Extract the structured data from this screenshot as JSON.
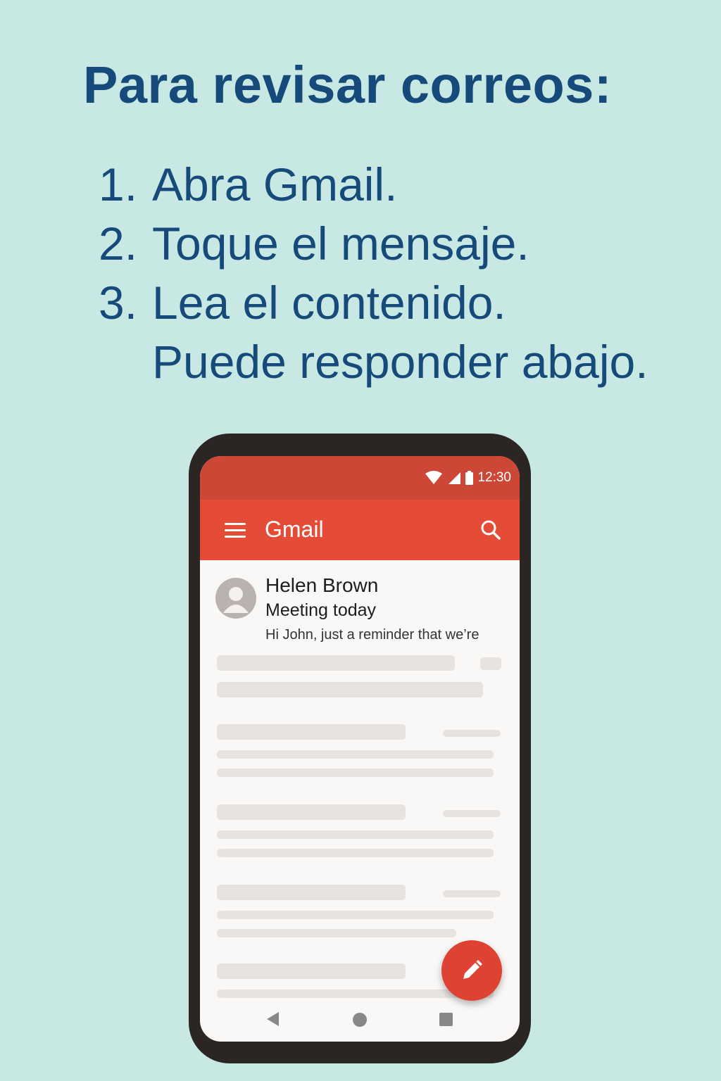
{
  "heading": "Para revisar correos:",
  "steps": [
    {
      "num": "1.",
      "text": "Abra Gmail."
    },
    {
      "num": "2.",
      "text": "Toque el mensaje."
    },
    {
      "num": "3.",
      "text": "Lea el contenido."
    }
  ],
  "step_continuation": "Puede responder abajo.",
  "phone": {
    "status_time": "12:30",
    "app_title": "Gmail",
    "email": {
      "sender": "Helen Brown",
      "subject": "Meeting today",
      "snippet": "Hi John, just a reminder that we’re"
    }
  },
  "colors": {
    "background": "#c8e9e3",
    "text": "#154a7a",
    "appbar": "#e44c38",
    "statusbar": "#cd4737",
    "fab": "#de4232"
  },
  "icons": [
    "wifi-icon",
    "signal-icon",
    "battery-icon",
    "menu-icon",
    "search-icon",
    "avatar-icon",
    "pencil-icon",
    "back-icon",
    "home-icon",
    "recents-icon"
  ]
}
